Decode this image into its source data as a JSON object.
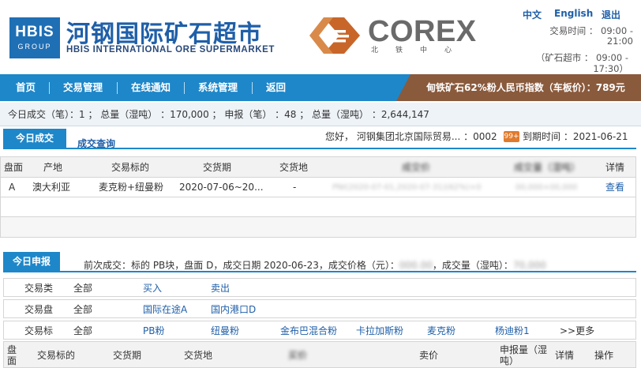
{
  "header": {
    "logo_top": "HBIS",
    "logo_bottom": "GROUP",
    "brand_cn": "河钢国际矿石超市",
    "brand_en": "HBIS INTERNATIONAL ORE  SUPERMARKET",
    "corex_name": "COREX",
    "corex_sub": "北铁中心",
    "lang_cn": "中文",
    "lang_en": "English",
    "logout": "退出",
    "trade_time_line1": "交易时间 ： 09:00 -",
    "trade_time_line2": "21:00",
    "ore_time_line1": "（矿石超市 ： 09:00 -",
    "ore_time_line2": "17:30）"
  },
  "nav": {
    "items": [
      "首页",
      "交易管理",
      "在线通知",
      "系统管理",
      "返回"
    ],
    "index_label": "甸铁矿石62%粉人民币指数（车板价）：789元"
  },
  "stats": {
    "text": "今日成交（笔）：1 ； 总量（湿吨） ：170,000 ； 申报（笔） ：48 ； 总量（湿吨） ：2,644,147"
  },
  "section1": {
    "tab_active": "今日成交",
    "tab_link": "成交查询",
    "welcome": "您好， 河钢集团北京国际贸易... ：0002",
    "badge": "99+",
    "expire": "到期时间 ：2021-06-21",
    "columns": [
      "盘面",
      "产地",
      "交易标的",
      "交货期",
      "交货地",
      "成交价",
      "成交量（湿吨）",
      "详情"
    ],
    "rows": [
      {
        "panel": "A",
        "origin": "澳大利亚",
        "target": "麦克粉+纽曼粉",
        "delivery_period": "2020-07-06~20...",
        "delivery_place": "-",
        "price": "PNI(2020-07-01,2020-07-31)(62%)+0",
        "volume": "00,000+00,000",
        "detail": "查看"
      }
    ]
  },
  "section2": {
    "tab_active": "今日申报",
    "prev_deal_prefix": "前次成交：标的 PB块，盘面 D，成交日期 2020-06-23，成交价格（元）：",
    "prev_price": "000.00",
    "prev_mid": "，成交量（湿吨）：",
    "prev_volume": "70,000",
    "filters": [
      {
        "label": "交易类",
        "all": "全部",
        "options": [
          "买入",
          "卖出"
        ]
      },
      {
        "label": "交易盘",
        "all": "全部",
        "options": [
          "国际在途A",
          "国内港口D"
        ]
      },
      {
        "label": "交易标",
        "all": "全部",
        "options": [
          "PB粉",
          "纽曼粉",
          "金布巴混合粉",
          "卡拉加斯粉",
          "麦克粉",
          "杨迪粉1",
          ">>更多"
        ]
      }
    ],
    "columns": [
      "盘面",
      "交易标的",
      "交货期",
      "交货地",
      "买价",
      "卖价",
      "申报量（湿吨）",
      "详情",
      "操作"
    ]
  },
  "colors": {
    "nav_blue": "#1e87c9",
    "brand_blue": "#1f5fa8",
    "index_brown": "#8a5a3c",
    "corex_orange": "#c8662a"
  }
}
